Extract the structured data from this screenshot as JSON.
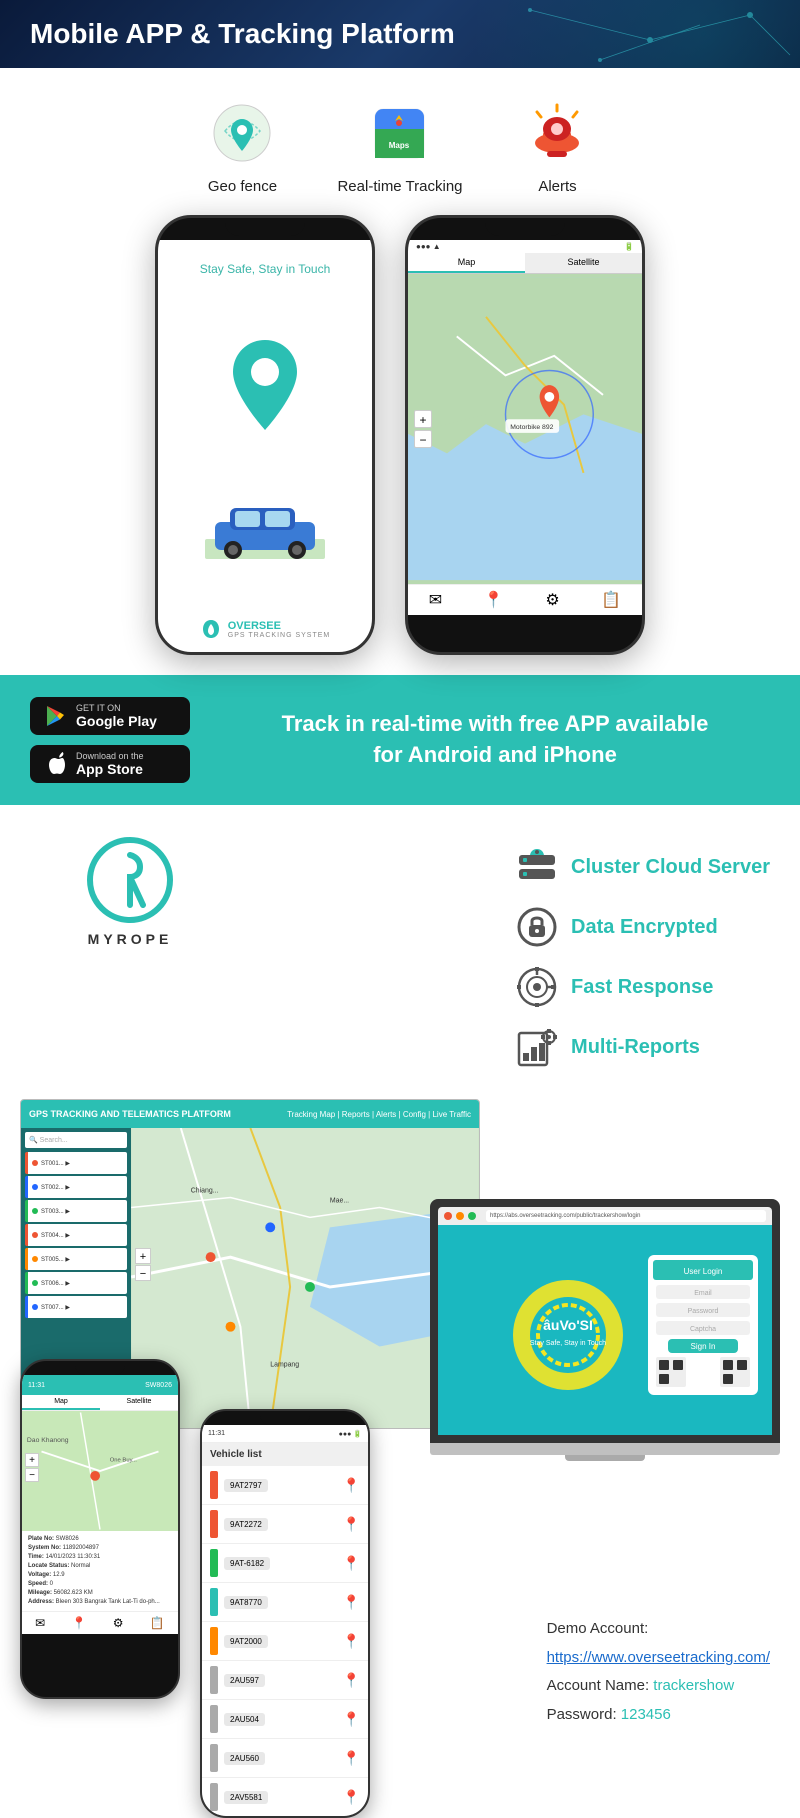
{
  "header": {
    "title": "Mobile APP & Tracking Platform"
  },
  "features": {
    "items": [
      {
        "id": "geo-fence",
        "label": "Geo fence",
        "icon": "📍"
      },
      {
        "id": "real-time-tracking",
        "label": "Real-time Tracking",
        "icon": "🗺️"
      },
      {
        "id": "alerts",
        "label": "Alerts",
        "icon": "🚨"
      }
    ]
  },
  "phone_left": {
    "tagline": "Stay Safe, Stay in Touch",
    "brand": "OVERSEE",
    "brand_sub": "GPS TRACKING SYSTEM"
  },
  "download": {
    "google_play_sub": "GET IT ON",
    "google_play_main": "Google Play",
    "app_store_sub": "Download on the",
    "app_store_main": "App Store",
    "text_line1": "Track in real-time with free APP available",
    "text_line2": "for Android and iPhone"
  },
  "myrope": {
    "name": "MYROPE"
  },
  "platform_features": [
    {
      "id": "cluster-cloud",
      "icon": "🖥️",
      "label": "Cluster Cloud Server"
    },
    {
      "id": "data-encrypted",
      "icon": "🔒",
      "label": "Data Encrypted"
    },
    {
      "id": "fast-response",
      "icon": "⚙️",
      "label": "Fast Response"
    },
    {
      "id": "multi-reports",
      "icon": "📊",
      "label": "Multi-Reports"
    }
  ],
  "demo": {
    "title": "Demo Account:",
    "url": "https://www.overseetracking.com/",
    "account_label": "Account Name:",
    "account_value": "trackershow",
    "password_label": "Password:",
    "password_value": "123456"
  },
  "vehicle_list": {
    "title": "Vehicle list",
    "items": [
      "9AT2797",
      "9AT2272",
      "9AT-6182",
      "9AT8770",
      "9AT2000",
      "2AU597",
      "2AU504",
      "2AU560",
      "2AV5581"
    ]
  },
  "colors": {
    "teal": "#2bbfb3",
    "dark_teal": "#1a8a80",
    "dark_blue": "#0a1a3a",
    "accent_blue": "#1a6bcc",
    "text_dark": "#222222"
  }
}
